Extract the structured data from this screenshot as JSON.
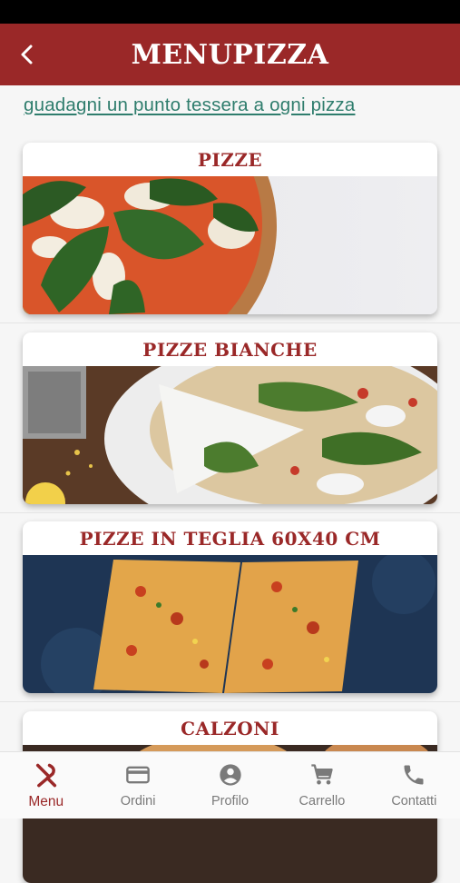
{
  "header": {
    "title": "MENUPIZZA",
    "back_icon": "chevron-left-icon"
  },
  "promo": {
    "text": "guadagni un punto tessera a ogni pizza"
  },
  "categories": [
    {
      "title": "PIZZE"
    },
    {
      "title": "PIZZE BIANCHE"
    },
    {
      "title": "PIZZE IN TEGLIA 60X40 CM"
    },
    {
      "title": "CALZONI"
    }
  ],
  "nav": {
    "items": [
      {
        "label": "Menu",
        "icon": "fork-knife-icon",
        "active": true
      },
      {
        "label": "Ordini",
        "icon": "card-icon",
        "active": false
      },
      {
        "label": "Profilo",
        "icon": "account-icon",
        "active": false
      },
      {
        "label": "Carrello",
        "icon": "cart-icon",
        "active": false
      },
      {
        "label": "Contatti",
        "icon": "phone-icon",
        "active": false
      }
    ]
  },
  "colors": {
    "brand": "#9a2828",
    "link": "#2f7d6d",
    "nav_inactive": "#7a7a7a"
  }
}
